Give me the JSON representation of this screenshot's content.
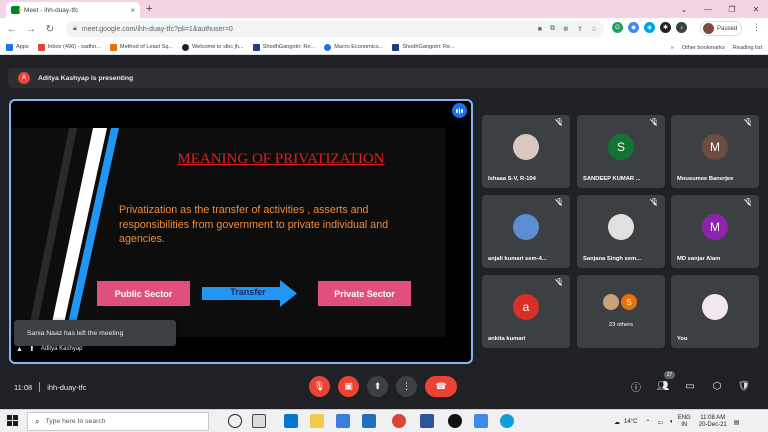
{
  "browser": {
    "tab_title": "Meet - ihh-duay-tfc",
    "tab_close": "×",
    "new_tab": "+",
    "url": "meet.google.com/ihh-duay-tfc?pli=1&authuser=0",
    "profile_label": "Paused",
    "bookmarks": [
      {
        "label": "Apps",
        "color": "#1a73e8"
      },
      {
        "label": "Inbox (496) - sadhn...",
        "color": "#ea4335"
      },
      {
        "label": "Method of Least Sq...",
        "color": "#e37400"
      },
      {
        "label": "Welcome to slbc jh...",
        "color": "#202124"
      },
      {
        "label": "ShodhGangotri: Re...",
        "color": "#1f3c88"
      },
      {
        "label": "Macro Economics...",
        "color": "#1a73e8"
      },
      {
        "label": "ShodhGangotri: Re...",
        "color": "#1f3c88"
      }
    ],
    "bookmarks_more": "»",
    "other_bookmarks": "Other bookmarks",
    "reading_list": "Reading list"
  },
  "meet": {
    "presenter_initial": "A",
    "presenter_banner": "Aditya Kashyap is presenting",
    "slide": {
      "title": "MEANING OF PRIVATIZATION",
      "body": "Privatization as the transfer of activities , asserts and responsibilities from government to private individual and agencies.",
      "left_box": "Public Sector",
      "arrow_label": "Transfer",
      "right_box": "Private Sector"
    },
    "toast": "Sania Naaz has left the meeting",
    "presenter_name": "Aditya Kashyap",
    "participants": [
      {
        "name": "Ishaaa S-V, R-104",
        "initial": "",
        "avatar_color": "#d8c8c0"
      },
      {
        "name": "SANDEEP KUMAR ...",
        "initial": "S",
        "avatar_color": "#137333"
      },
      {
        "name": "Mousumee Banerjee",
        "initial": "M",
        "avatar_color": "#6d4c41"
      },
      {
        "name": "anjali kumari sem-4...",
        "initial": "",
        "avatar_color": "#5b8fd1"
      },
      {
        "name": "Sanjana Singh sem...",
        "initial": "",
        "avatar_color": "#e0e0e0"
      },
      {
        "name": "MD sanjar Alam",
        "initial": "M",
        "avatar_color": "#8e24aa"
      },
      {
        "name": "ankita kumari",
        "initial": "a",
        "avatar_color": "#d93025"
      },
      {
        "name": "23 others",
        "initial": "S",
        "avatar_color": "#e8710a"
      },
      {
        "name": "You",
        "initial": "",
        "avatar_color": "#f2e6f0"
      }
    ],
    "time": "11:08",
    "meeting_code": "ihh-duay-tfc",
    "people_count": "37"
  },
  "taskbar": {
    "search_placeholder": "Type here to search",
    "temperature": "14°C",
    "lang_top": "ENG",
    "lang_bottom": "IN",
    "clock_time": "11:08 AM",
    "clock_date": "20-Dec-21"
  },
  "colors": {
    "accent": "#8ab4f8",
    "end_call": "#ea4335",
    "muted": "#ea4335",
    "slide_title": "#e02020",
    "slide_body": "#f08c3c",
    "slide_box": "#e0507a",
    "arrow": "#2196f3"
  }
}
